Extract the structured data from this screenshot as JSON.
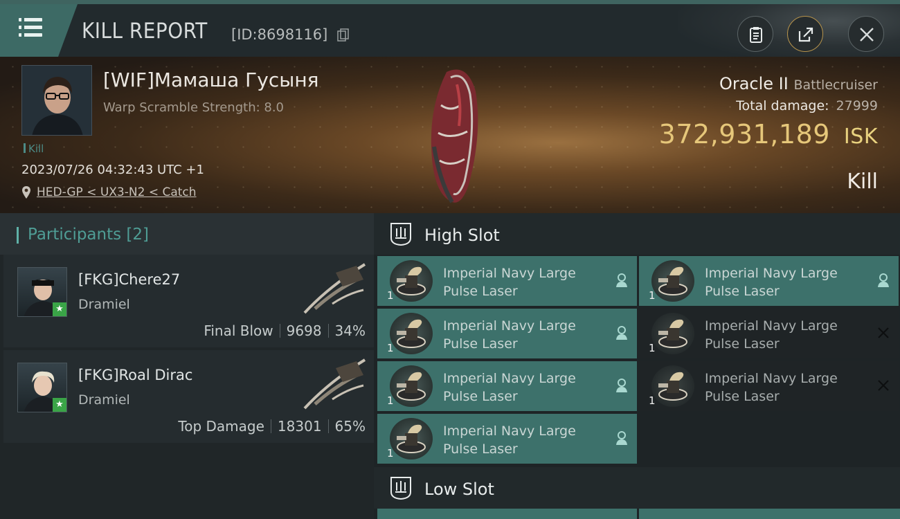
{
  "header": {
    "title": "KILL REPORT",
    "report_id": "[ID:8698116]"
  },
  "victim": {
    "name": "[WIF]Мамаша Гусыня",
    "warp_scramble": "Warp Scramble Strength: 8.0",
    "tag": "Kill",
    "datetime": "2023/07/26 04:32:43 UTC +1",
    "location": "HED-GP < UX3-N2 < Catch",
    "ship_name": "Oracle II",
    "ship_class": "Battlecruiser",
    "total_damage_label": "Total damage:",
    "total_damage": "27999",
    "isk_value": "372,931,189",
    "isk_unit": "ISK",
    "result": "Kill"
  },
  "participants": {
    "header": "Participants [2]",
    "items": [
      {
        "name": "[FKG]Chere27",
        "ship": "Dramiel",
        "role": "Final Blow",
        "damage": "9698",
        "percent": "34%"
      },
      {
        "name": "[FKG]Roal Dirac",
        "ship": "Dramiel",
        "role": "Top Damage",
        "damage": "18301",
        "percent": "65%"
      }
    ]
  },
  "slots": {
    "high_label": "High Slot",
    "low_label": "Low Slot",
    "high": [
      {
        "name_line1": "Imperial Navy Large",
        "name_line2": "Pulse Laser",
        "qty": "1",
        "state": "dropped"
      },
      {
        "name_line1": "Imperial Navy Large",
        "name_line2": "Pulse Laser",
        "qty": "1",
        "state": "dropped"
      },
      {
        "name_line1": "Imperial Navy Large",
        "name_line2": "Pulse Laser",
        "qty": "1",
        "state": "dropped"
      },
      {
        "name_line1": "Imperial Navy Large",
        "name_line2": "Pulse Laser",
        "qty": "1",
        "state": "destroyed"
      },
      {
        "name_line1": "Imperial Navy Large",
        "name_line2": "Pulse Laser",
        "qty": "1",
        "state": "dropped"
      },
      {
        "name_line1": "Imperial Navy Large",
        "name_line2": "Pulse Laser",
        "qty": "1",
        "state": "destroyed"
      },
      {
        "name_line1": "Imperial Navy Large",
        "name_line2": "Pulse Laser",
        "qty": "1",
        "state": "dropped"
      }
    ]
  },
  "colors": {
    "accent_teal": "#3d716b",
    "isk_gold": "#e6c77a",
    "participants_header": "#4f9d95"
  }
}
